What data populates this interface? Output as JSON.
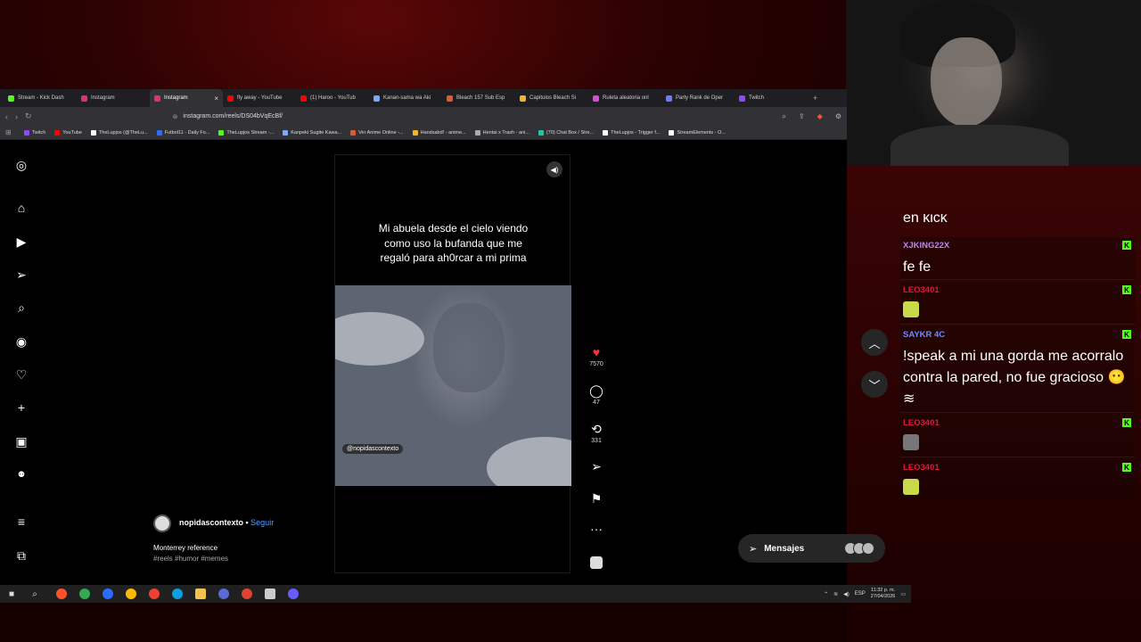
{
  "tabs": [
    {
      "label": "Stream - Kick Dash",
      "color": "#53fc18",
      "active": false
    },
    {
      "label": "Instagram",
      "color": "#e1306c",
      "active": false
    },
    {
      "label": "Instagram",
      "color": "#e1306c",
      "active": true
    },
    {
      "label": "fly away - YouTube",
      "color": "#ff0000",
      "active": false
    },
    {
      "label": "(1) Haroo - YouTub",
      "color": "#ff0000",
      "active": false
    },
    {
      "label": "Kanan-sama wa Aki",
      "color": "#7aa7ff",
      "active": false
    },
    {
      "label": "Bleach 157 Sub Esp",
      "color": "#e05a2b",
      "active": false
    },
    {
      "label": "Capitulos Bleach Si",
      "color": "#f0b429",
      "active": false
    },
    {
      "label": "Ruleta aleatoria onl",
      "color": "#d94bd2",
      "active": false
    },
    {
      "label": "Party Rank de Oper",
      "color": "#6b7cff",
      "active": false
    },
    {
      "label": "Twitch",
      "color": "#9146ff",
      "active": false
    }
  ],
  "address": {
    "url": "instagram.com/reels/DS04bVqEcBf/"
  },
  "bookmarks": [
    {
      "label": "Twitch",
      "color": "#9146ff"
    },
    {
      "label": "YouTube",
      "color": "#ff0000"
    },
    {
      "label": "TheLupjos (@TheLu...",
      "color": "#ffffff"
    },
    {
      "label": "Futbol11 - Daily Fo...",
      "color": "#2b6cff"
    },
    {
      "label": "TheLupjos Stream -...",
      "color": "#53fc18"
    },
    {
      "label": "Kanpeki Sugite Kawa...",
      "color": "#7aa7ff"
    },
    {
      "label": "Ver Anime Online -...",
      "color": "#e05a2b"
    },
    {
      "label": "Handsabd! - anime...",
      "color": "#f0b429"
    },
    {
      "label": "Hentai x Trash - ani...",
      "color": "#aaaaaa"
    },
    {
      "label": "(70) Chat Box / Stre...",
      "color": "#22c3a6"
    },
    {
      "label": "TheLupjos - Trigger f...",
      "color": "#ffffff"
    },
    {
      "label": "StreamElements - O...",
      "color": "#ffffff"
    }
  ],
  "reel": {
    "caption": "Mi abuela desde el cielo viendo como uso la bufanda que me regaló para ah0rcar a mi prima",
    "video_tag": "@nopidascontexto",
    "likes": "7570",
    "comments": "47",
    "reposts": "331"
  },
  "author": {
    "username": "nopidascontexto",
    "separator": " • ",
    "follow": "Seguir",
    "description": "Monterrey reference",
    "hashtags": "#reels #humor #memes"
  },
  "messages": {
    "label": "Mensajes"
  },
  "clock": {
    "time": "11:32 p. m.",
    "date": "27/04/2026",
    "lang": "ESP"
  },
  "chat": {
    "partial": "en kick",
    "items": [
      {
        "user": "XJKING22X",
        "user_color": "#c084fc",
        "text": "fe fe",
        "emote": null
      },
      {
        "user": "LEO3401",
        "user_color": "#e0163c",
        "text": "",
        "emote": "#c8d94a"
      },
      {
        "user": "SAYKR 4C",
        "user_color": "#6f8cff",
        "text": "!speak a mi una gorda me acorralo contra la pared, no fue gracioso 😶 ≋",
        "emote": null
      },
      {
        "user": "LEO3401",
        "user_color": "#e0163c",
        "text": "",
        "emote": "#777777"
      },
      {
        "user": "LEO3401",
        "user_color": "#e0163c",
        "text": "",
        "emote": "#c8d94a"
      }
    ]
  }
}
